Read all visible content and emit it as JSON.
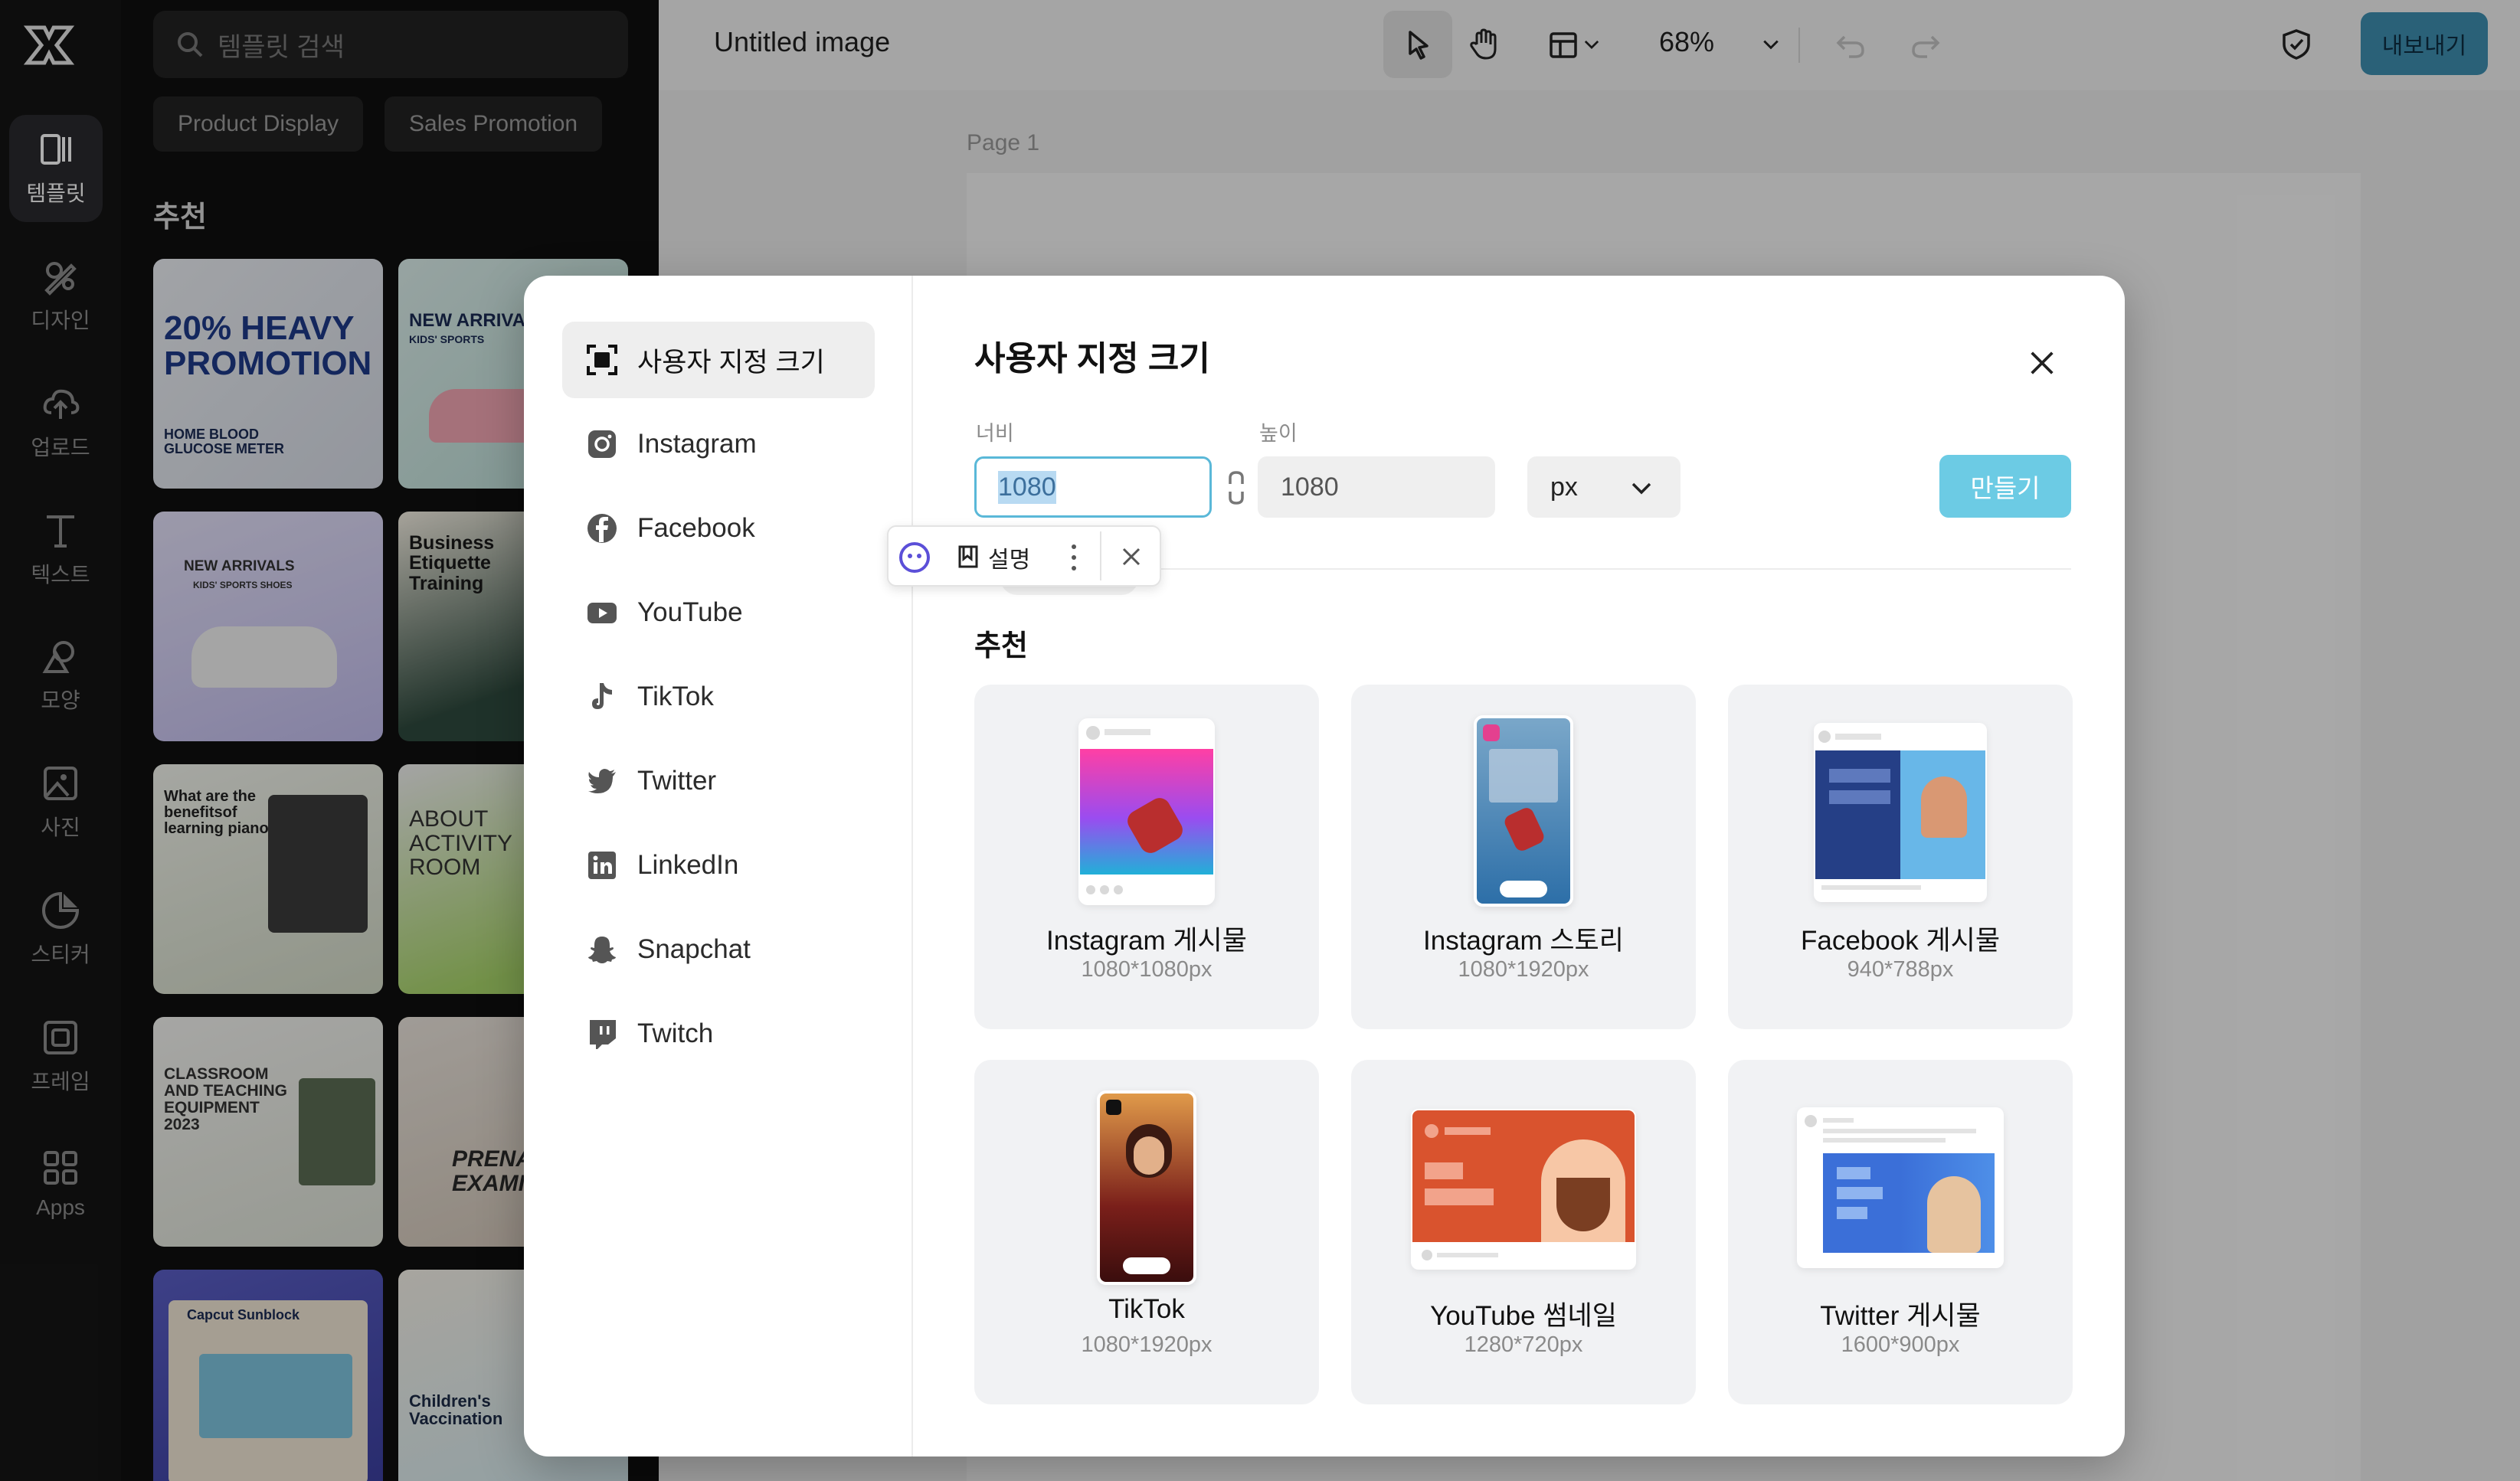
{
  "rail": {
    "items": [
      {
        "label": "템플릿",
        "icon": "template-icon"
      },
      {
        "label": "디자인",
        "icon": "design-icon"
      },
      {
        "label": "업로드",
        "icon": "upload-icon"
      },
      {
        "label": "텍스트",
        "icon": "text-icon"
      },
      {
        "label": "모양",
        "icon": "shapes-icon"
      },
      {
        "label": "사진",
        "icon": "photo-icon"
      },
      {
        "label": "스티커",
        "icon": "sticker-icon"
      },
      {
        "label": "프레임",
        "icon": "frame-icon"
      },
      {
        "label": "Apps",
        "icon": "apps-icon"
      }
    ]
  },
  "panel": {
    "search_placeholder": "템플릿 검색",
    "chips": [
      "Product Display",
      "Sales Promotion"
    ],
    "section_title": "추천",
    "templates": [
      {
        "text": "20% HEAVY PROMOTION",
        "sub": "HOME BLOOD GLUCOSE METER"
      },
      {
        "text": "NEW ARRIVALS",
        "sub": "KIDS' SPORTS"
      },
      {
        "text": "NEW ARRIVALS",
        "sub": "KIDS' SPORTS SHOES"
      },
      {
        "text": "Business Etiquette Training",
        "sub": ""
      },
      {
        "text": "What are the benefitsof learning piano",
        "sub": ""
      },
      {
        "text": "ABOUT ACTIVITY ROOM",
        "sub": ""
      },
      {
        "text": "CLASSROOM AND TEACHING EQUIPMENT 2023",
        "sub": ""
      },
      {
        "text": "PRENA EXAMIN",
        "sub": ""
      },
      {
        "text": "Capcut Sunblock",
        "sub": ""
      },
      {
        "text": "Children's Vaccination",
        "sub": ""
      }
    ]
  },
  "topbar": {
    "title": "Untitled image",
    "zoom": "68%",
    "export_label": "내보내기"
  },
  "canvas": {
    "page_label": "Page 1"
  },
  "modal": {
    "title": "사용자 지정 크기",
    "sidebar": [
      {
        "label": "사용자 지정 크기",
        "icon": "custom-size-icon"
      },
      {
        "label": "Instagram",
        "icon": "instagram-icon"
      },
      {
        "label": "Facebook",
        "icon": "facebook-icon"
      },
      {
        "label": "YouTube",
        "icon": "youtube-icon"
      },
      {
        "label": "TikTok",
        "icon": "tiktok-icon"
      },
      {
        "label": "Twitter",
        "icon": "twitter-icon"
      },
      {
        "label": "LinkedIn",
        "icon": "linkedin-icon"
      },
      {
        "label": "Snapchat",
        "icon": "snapchat-icon"
      },
      {
        "label": "Twitch",
        "icon": "twitch-icon"
      }
    ],
    "width_label": "너비",
    "width_value": "1080",
    "height_label": "높이",
    "height_value": "1080",
    "unit": "px",
    "create_label": "만들기",
    "popup_label": "설명",
    "recommended_title": "추천",
    "presets": [
      {
        "name": "Instagram 게시물",
        "size": "1080*1080px"
      },
      {
        "name": "Instagram 스토리",
        "size": "1080*1920px"
      },
      {
        "name": "Facebook 게시물",
        "size": "940*788px"
      },
      {
        "name": "TikTok",
        "size": "1080*1920px"
      },
      {
        "name": "YouTube 썸네일",
        "size": "1280*720px"
      },
      {
        "name": "Twitter 게시물",
        "size": "1600*900px"
      }
    ]
  },
  "colors": {
    "accent": "#6ccbe4",
    "export": "#3f8fb2",
    "rail_bg": "#141414",
    "panel_bg": "#0f0f0f"
  }
}
